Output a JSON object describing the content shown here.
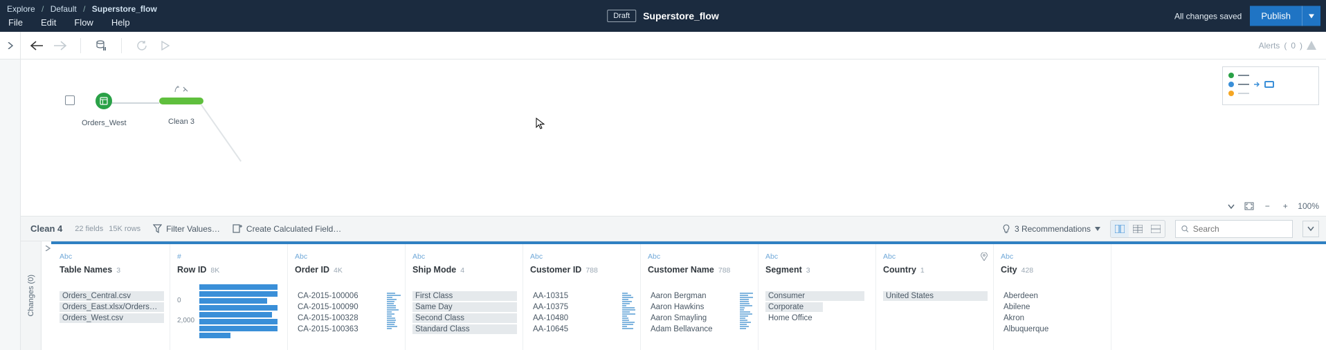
{
  "breadcrumb": {
    "root": "Explore",
    "space": "Default",
    "flow": "Superstore_flow"
  },
  "menubar": [
    "File",
    "Edit",
    "Flow",
    "Help"
  ],
  "draft_label": "Draft",
  "flow_title": "Superstore_flow",
  "saved_label": "All changes saved",
  "publish_label": "Publish",
  "alerts": {
    "label": "Alerts",
    "count": "0"
  },
  "canvas": {
    "nodes": {
      "input": {
        "label": "Orders_West"
      },
      "clean3": {
        "label": "Clean 3"
      }
    },
    "zoom": "100%"
  },
  "step": {
    "name": "Clean 4",
    "fields": "22 fields",
    "rows": "15K rows",
    "filter_label": "Filter Values…",
    "calc_label": "Create Calculated Field…",
    "recs_label": "3 Recommendations",
    "search_placeholder": "Search"
  },
  "changes_label": "Changes (0)",
  "fields": [
    {
      "type": "Abc",
      "name": "Table Names",
      "count": "3",
      "values": [
        {
          "t": "Orders_Central.csv",
          "sel": true
        },
        {
          "t": "Orders_East.xlsx/Orders_E…",
          "sel": true
        },
        {
          "t": "Orders_West.csv",
          "sel": true
        }
      ]
    },
    {
      "type": "#",
      "name": "Row ID",
      "count": "8K",
      "axis": [
        "0",
        "2,000"
      ],
      "bars": [
        0.95,
        0.95,
        0.82,
        0.95,
        0.88,
        0.95,
        0.95,
        0.38
      ]
    },
    {
      "type": "Abc",
      "name": "Order ID",
      "count": "4K",
      "mini": true,
      "values": [
        {
          "t": "CA-2015-100006"
        },
        {
          "t": "CA-2015-100090"
        },
        {
          "t": "CA-2015-100328"
        },
        {
          "t": "CA-2015-100363"
        }
      ]
    },
    {
      "type": "Abc",
      "name": "Ship Mode",
      "count": "4",
      "values": [
        {
          "t": "First Class",
          "sel": true
        },
        {
          "t": "Same Day",
          "sel": true
        },
        {
          "t": "Second Class",
          "sel": true
        },
        {
          "t": "Standard Class",
          "sel": true
        }
      ]
    },
    {
      "type": "Abc",
      "name": "Customer ID",
      "count": "788",
      "mini": true,
      "values": [
        {
          "t": "AA-10315"
        },
        {
          "t": "AA-10375"
        },
        {
          "t": "AA-10480"
        },
        {
          "t": "AA-10645"
        }
      ]
    },
    {
      "type": "Abc",
      "name": "Customer Name",
      "count": "788",
      "mini": true,
      "values": [
        {
          "t": "Aaron Bergman"
        },
        {
          "t": "Aaron Hawkins"
        },
        {
          "t": "Aaron Smayling"
        },
        {
          "t": "Adam Bellavance"
        }
      ]
    },
    {
      "type": "Abc",
      "name": "Segment",
      "count": "3",
      "values": [
        {
          "t": "Consumer",
          "sel": true,
          "w": 0.95
        },
        {
          "t": "Corporate",
          "sel": true,
          "w": 0.55
        },
        {
          "t": "Home Office"
        }
      ]
    },
    {
      "type": "Abc",
      "name": "Country",
      "count": "1",
      "pin": true,
      "values": [
        {
          "t": "United States",
          "sel": true
        }
      ]
    },
    {
      "type": "Abc",
      "name": "City",
      "count": "428",
      "values": [
        {
          "t": "Aberdeen"
        },
        {
          "t": "Abilene"
        },
        {
          "t": "Akron"
        },
        {
          "t": "Albuquerque"
        }
      ]
    }
  ]
}
